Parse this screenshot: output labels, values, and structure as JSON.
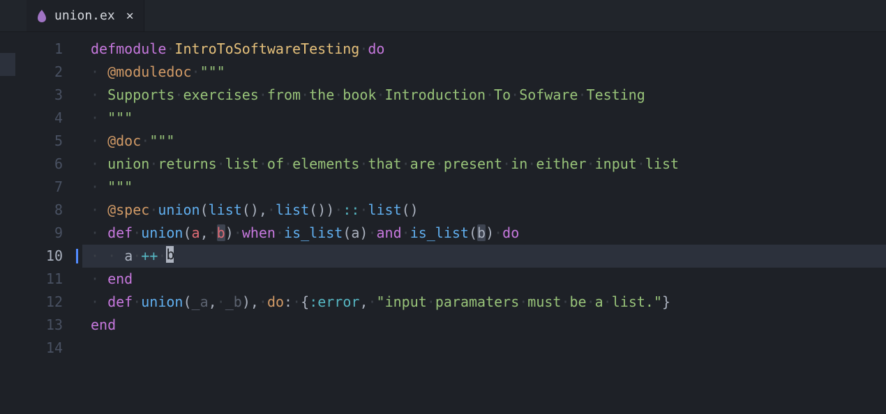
{
  "tab": {
    "filename": "union.ex",
    "icon": "elixir-icon"
  },
  "editor": {
    "active_line": 10,
    "lines": [
      {
        "n": 1,
        "tokens": [
          {
            "t": "defmodule",
            "c": "kw"
          },
          {
            "t": " ",
            "c": "ws-dot"
          },
          {
            "t": "IntroToSoftwareTesting",
            "c": "mod"
          },
          {
            "t": " ",
            "c": "ws-dot"
          },
          {
            "t": "do",
            "c": "kw"
          }
        ]
      },
      {
        "n": 2,
        "indent": 1,
        "tokens": [
          {
            "t": "@moduledoc",
            "c": "attr"
          },
          {
            "t": " ",
            "c": "ws-dot"
          },
          {
            "t": "\"\"\"",
            "c": "str"
          }
        ]
      },
      {
        "n": 3,
        "indent": 1,
        "tokens": [
          {
            "t": "Supports",
            "c": "str"
          },
          {
            "t": " ",
            "c": "ws-dot"
          },
          {
            "t": "exercises",
            "c": "str"
          },
          {
            "t": " ",
            "c": "ws-dot"
          },
          {
            "t": "from",
            "c": "str"
          },
          {
            "t": " ",
            "c": "ws-dot"
          },
          {
            "t": "the",
            "c": "str"
          },
          {
            "t": " ",
            "c": "ws-dot"
          },
          {
            "t": "book",
            "c": "str"
          },
          {
            "t": " ",
            "c": "ws-dot"
          },
          {
            "t": "Introduction",
            "c": "str"
          },
          {
            "t": " ",
            "c": "ws-dot"
          },
          {
            "t": "To",
            "c": "str"
          },
          {
            "t": " ",
            "c": "ws-dot"
          },
          {
            "t": "Sofware",
            "c": "str"
          },
          {
            "t": " ",
            "c": "ws-dot"
          },
          {
            "t": "Testing",
            "c": "str"
          }
        ]
      },
      {
        "n": 4,
        "indent": 1,
        "tokens": [
          {
            "t": "\"\"\"",
            "c": "str"
          }
        ]
      },
      {
        "n": 5,
        "indent": 1,
        "tokens": [
          {
            "t": "@doc",
            "c": "attr"
          },
          {
            "t": " ",
            "c": "ws-dot"
          },
          {
            "t": "\"\"\"",
            "c": "str"
          }
        ]
      },
      {
        "n": 6,
        "indent": 1,
        "tokens": [
          {
            "t": "union",
            "c": "str"
          },
          {
            "t": " ",
            "c": "ws-dot"
          },
          {
            "t": "returns",
            "c": "str"
          },
          {
            "t": " ",
            "c": "ws-dot"
          },
          {
            "t": "list",
            "c": "str"
          },
          {
            "t": " ",
            "c": "ws-dot"
          },
          {
            "t": "of",
            "c": "str"
          },
          {
            "t": " ",
            "c": "ws-dot"
          },
          {
            "t": "elements",
            "c": "str"
          },
          {
            "t": " ",
            "c": "ws-dot"
          },
          {
            "t": "that",
            "c": "str"
          },
          {
            "t": " ",
            "c": "ws-dot"
          },
          {
            "t": "are",
            "c": "str"
          },
          {
            "t": " ",
            "c": "ws-dot"
          },
          {
            "t": "present",
            "c": "str"
          },
          {
            "t": " ",
            "c": "ws-dot"
          },
          {
            "t": "in",
            "c": "str"
          },
          {
            "t": " ",
            "c": "ws-dot"
          },
          {
            "t": "either",
            "c": "str"
          },
          {
            "t": " ",
            "c": "ws-dot"
          },
          {
            "t": "input",
            "c": "str"
          },
          {
            "t": " ",
            "c": "ws-dot"
          },
          {
            "t": "list",
            "c": "str"
          }
        ]
      },
      {
        "n": 7,
        "indent": 1,
        "tokens": [
          {
            "t": "\"\"\"",
            "c": "str"
          }
        ]
      },
      {
        "n": 8,
        "indent": 1,
        "tokens": [
          {
            "t": "@spec",
            "c": "attr"
          },
          {
            "t": " ",
            "c": "ws-dot"
          },
          {
            "t": "union",
            "c": "fn"
          },
          {
            "t": "(",
            "c": "punct"
          },
          {
            "t": "list",
            "c": "fn"
          },
          {
            "t": "(),",
            "c": "punct"
          },
          {
            "t": " ",
            "c": "ws-dot"
          },
          {
            "t": "list",
            "c": "fn"
          },
          {
            "t": "())",
            "c": "punct"
          },
          {
            "t": " ",
            "c": "ws-dot"
          },
          {
            "t": "::",
            "c": "op"
          },
          {
            "t": " ",
            "c": "ws-dot"
          },
          {
            "t": "list",
            "c": "fn"
          },
          {
            "t": "()",
            "c": "punct"
          }
        ]
      },
      {
        "n": 9,
        "indent": 1,
        "tokens": [
          {
            "t": "def",
            "c": "kw"
          },
          {
            "t": " ",
            "c": "ws-dot"
          },
          {
            "t": "union",
            "c": "fn"
          },
          {
            "t": "(",
            "c": "punct"
          },
          {
            "t": "a",
            "c": "param"
          },
          {
            "t": ",",
            "c": "punct"
          },
          {
            "t": " ",
            "c": "ws-dot"
          },
          {
            "t": "b",
            "c": "param",
            "sel": true
          },
          {
            "t": ")",
            "c": "punct"
          },
          {
            "t": " ",
            "c": "ws-dot"
          },
          {
            "t": "when",
            "c": "kw"
          },
          {
            "t": " ",
            "c": "ws-dot"
          },
          {
            "t": "is_list",
            "c": "fn"
          },
          {
            "t": "(",
            "c": "punct"
          },
          {
            "t": "a",
            "c": "var"
          },
          {
            "t": ")",
            "c": "punct"
          },
          {
            "t": " ",
            "c": "ws-dot"
          },
          {
            "t": "and",
            "c": "kw"
          },
          {
            "t": " ",
            "c": "ws-dot"
          },
          {
            "t": "is_list",
            "c": "fn"
          },
          {
            "t": "(",
            "c": "punct"
          },
          {
            "t": "b",
            "c": "var",
            "sel": true
          },
          {
            "t": ")",
            "c": "punct"
          },
          {
            "t": " ",
            "c": "ws-dot"
          },
          {
            "t": "do",
            "c": "kw"
          }
        ]
      },
      {
        "n": 10,
        "indent": 2,
        "active": true,
        "tokens": [
          {
            "t": "a",
            "c": "var"
          },
          {
            "t": " ",
            "c": "ws-dot"
          },
          {
            "t": "++",
            "c": "op"
          },
          {
            "t": " ",
            "c": "ws-dot"
          },
          {
            "t": "b",
            "c": "var",
            "cursor": true
          }
        ]
      },
      {
        "n": 11,
        "indent": 1,
        "tokens": [
          {
            "t": "end",
            "c": "kw"
          }
        ]
      },
      {
        "n": 12,
        "indent": 1,
        "tokens": [
          {
            "t": "def",
            "c": "kw"
          },
          {
            "t": " ",
            "c": "ws-dot"
          },
          {
            "t": "union",
            "c": "fn"
          },
          {
            "t": "(",
            "c": "punct"
          },
          {
            "t": "_a",
            "c": "unused"
          },
          {
            "t": ",",
            "c": "punct"
          },
          {
            "t": " ",
            "c": "ws-dot"
          },
          {
            "t": "_b",
            "c": "unused"
          },
          {
            "t": "),",
            "c": "punct"
          },
          {
            "t": " ",
            "c": "ws-dot"
          },
          {
            "t": "do",
            "c": "attr"
          },
          {
            "t": ":",
            "c": "punct"
          },
          {
            "t": " ",
            "c": "ws-dot"
          },
          {
            "t": "{",
            "c": "punct"
          },
          {
            "t": ":error",
            "c": "atom"
          },
          {
            "t": ",",
            "c": "punct"
          },
          {
            "t": " ",
            "c": "ws-dot"
          },
          {
            "t": "\"input",
            "c": "str"
          },
          {
            "t": " ",
            "c": "ws-dot"
          },
          {
            "t": "paramaters",
            "c": "str"
          },
          {
            "t": " ",
            "c": "ws-dot"
          },
          {
            "t": "must",
            "c": "str"
          },
          {
            "t": " ",
            "c": "ws-dot"
          },
          {
            "t": "be",
            "c": "str"
          },
          {
            "t": " ",
            "c": "ws-dot"
          },
          {
            "t": "a",
            "c": "str"
          },
          {
            "t": " ",
            "c": "ws-dot"
          },
          {
            "t": "list.\"",
            "c": "str"
          },
          {
            "t": "}",
            "c": "punct"
          }
        ]
      },
      {
        "n": 13,
        "tokens": [
          {
            "t": "end",
            "c": "kw"
          }
        ]
      },
      {
        "n": 14,
        "tokens": []
      }
    ]
  }
}
